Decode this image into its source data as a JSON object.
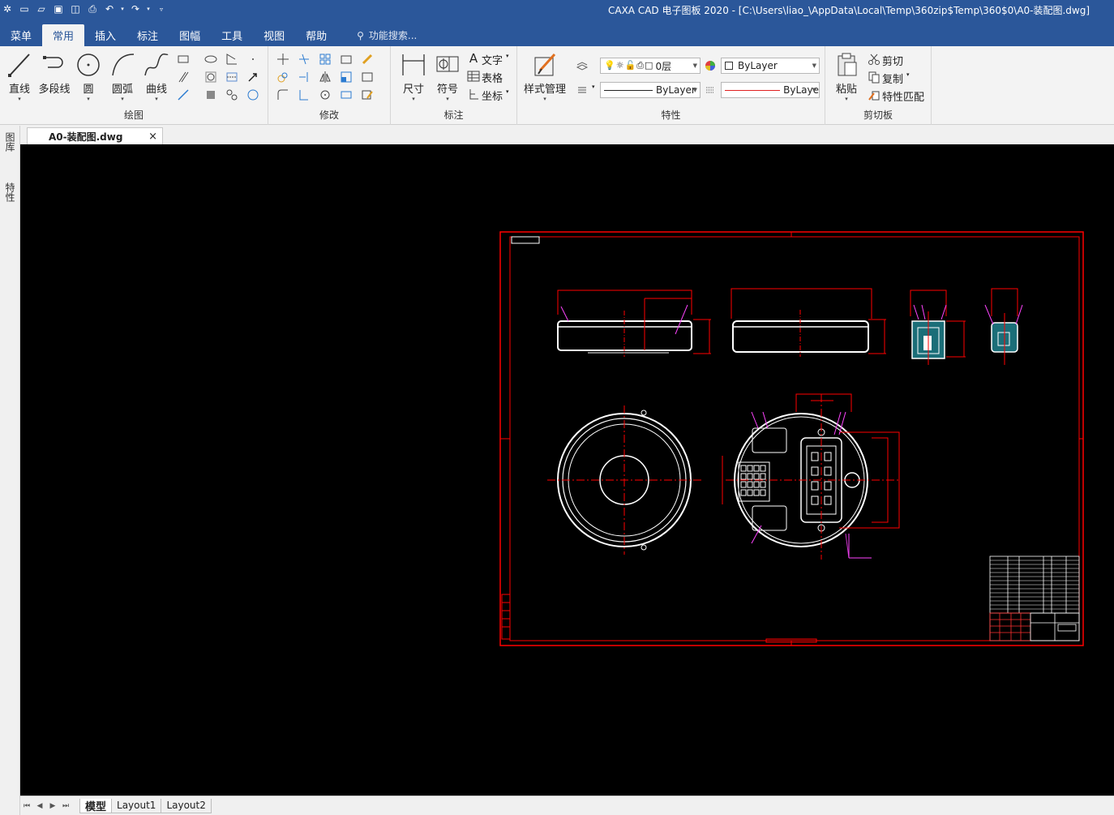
{
  "titlebar": {
    "title": "CAXA CAD 电子图板 2020 - [C:\\Users\\liao_\\AppData\\Local\\Temp\\360zip$Temp\\360$0\\A0-装配图.dwg]"
  },
  "menubar": {
    "tabs": [
      "菜单",
      "常用",
      "插入",
      "标注",
      "图幅",
      "工具",
      "视图",
      "帮助"
    ],
    "active": "常用",
    "search_placeholder": "功能搜索..."
  },
  "ribbon": {
    "draw": {
      "label": "绘图",
      "line": "直线",
      "polyline": "多段线",
      "circle": "圆",
      "arc": "圆弧",
      "curve": "曲线"
    },
    "modify": {
      "label": "修改"
    },
    "annotate": {
      "label": "标注",
      "dimension": "尺寸",
      "symbol": "符号",
      "text": "文字",
      "table": "表格",
      "coordinate": "坐标"
    },
    "properties": {
      "label": "特性",
      "style_manager": "样式管理",
      "layer": "0层",
      "color": "ByLayer",
      "linetype": "ByLayer",
      "lineweight": "ByLaye"
    },
    "clipboard": {
      "label": "剪切板",
      "paste": "粘贴",
      "cut": "剪切",
      "copy": "复制",
      "match": "特性匹配"
    }
  },
  "document": {
    "tab_name": "A0-装配图.dwg"
  },
  "left_panel": {
    "tab1": "图库",
    "tab2": "特性"
  },
  "layouts": {
    "tabs": [
      "模型",
      "Layout1",
      "Layout2"
    ],
    "active": "模型"
  },
  "colors": {
    "title_blue": "#2b579a",
    "canvas": "#000000",
    "frame_red": "#ff0000",
    "geometry": "#ffffff",
    "leader": "#cc33cc",
    "hatch": "#33cccc"
  }
}
